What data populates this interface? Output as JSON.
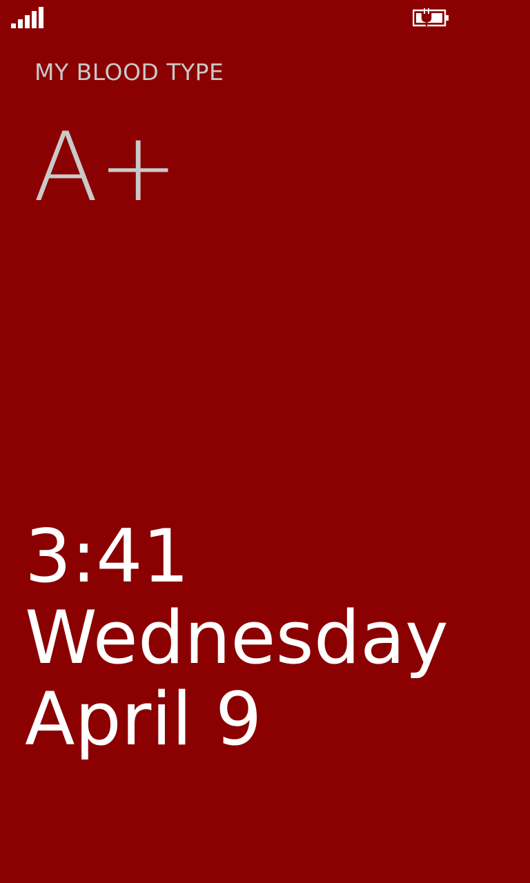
{
  "status_bar": {
    "signal_icon": "signal-strength-icon",
    "battery_icon": "battery-charging-icon"
  },
  "card": {
    "heading": "MY BLOOD TYPE",
    "blood_type": "A+"
  },
  "lock": {
    "time": "3:41",
    "day": "Wednesday",
    "date": "April 9"
  },
  "colors": {
    "background": "#8b0000",
    "card_text": "#c9c9c9",
    "clock_text": "#ffffff"
  }
}
